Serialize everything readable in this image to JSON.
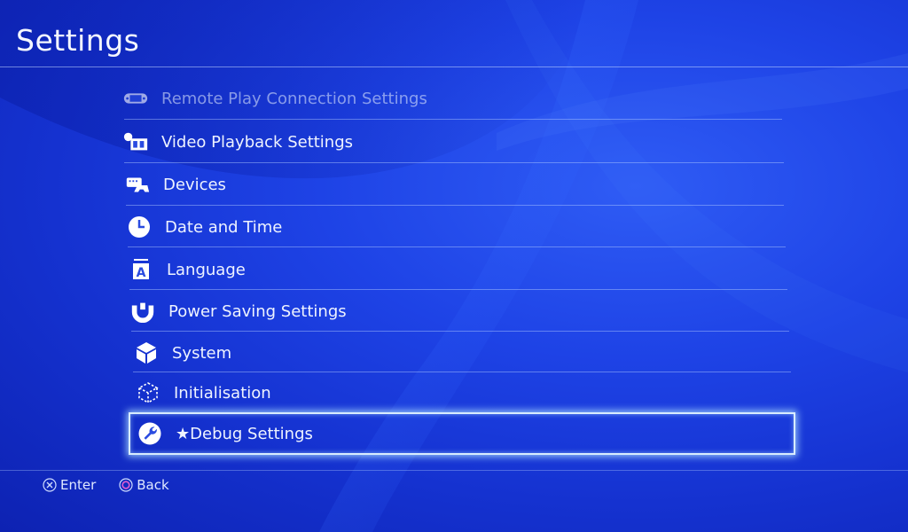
{
  "screen": {
    "title": "Settings"
  },
  "menu": {
    "items": [
      {
        "label": "Remote Play Connection Settings",
        "icon": "ps-vita-icon"
      },
      {
        "label": "Video Playback Settings",
        "icon": "video-film-icon"
      },
      {
        "label": "Devices",
        "icon": "devices-icon"
      },
      {
        "label": "Date and Time",
        "icon": "clock-icon"
      },
      {
        "label": "Language",
        "icon": "language-icon"
      },
      {
        "label": "Power Saving Settings",
        "icon": "power-saving-icon"
      },
      {
        "label": "System",
        "icon": "cube-icon"
      },
      {
        "label": "Initialisation",
        "icon": "initialisation-icon"
      },
      {
        "label": "★Debug Settings",
        "icon": "wrench-icon"
      }
    ],
    "selected_label": "★Debug Settings"
  },
  "footer": {
    "enter_label": "Enter",
    "back_label": "Back"
  },
  "colors": {
    "background": "#1e43e6",
    "selection_glow": "#aadcff",
    "circle_button": "#e05fd0"
  }
}
